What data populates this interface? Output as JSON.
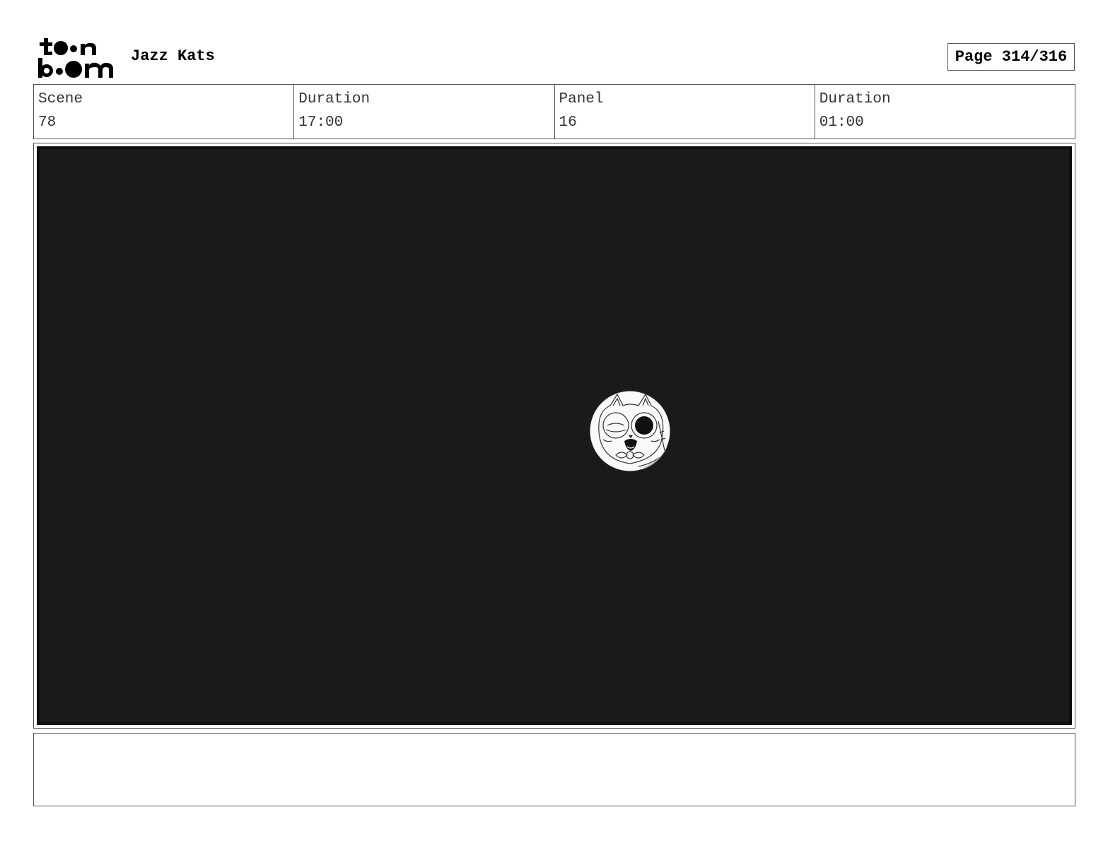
{
  "logo": {
    "top_line": "toon",
    "bottom_line": "boom",
    "icon": "toon-boom-logo"
  },
  "header": {
    "project_title": "Jazz Kats",
    "page_label": "Page 314/316"
  },
  "info": {
    "scene_label": "Scene",
    "scene_value": "78",
    "scene_duration_label": "Duration",
    "scene_duration_value": "17:00",
    "panel_label": "Panel",
    "panel_value": "16",
    "panel_duration_label": "Duration",
    "panel_duration_value": "01:00"
  },
  "panel": {
    "background_color": "#1a1a1a",
    "iris_icon": "cat-face-iris-icon"
  },
  "notes": {}
}
